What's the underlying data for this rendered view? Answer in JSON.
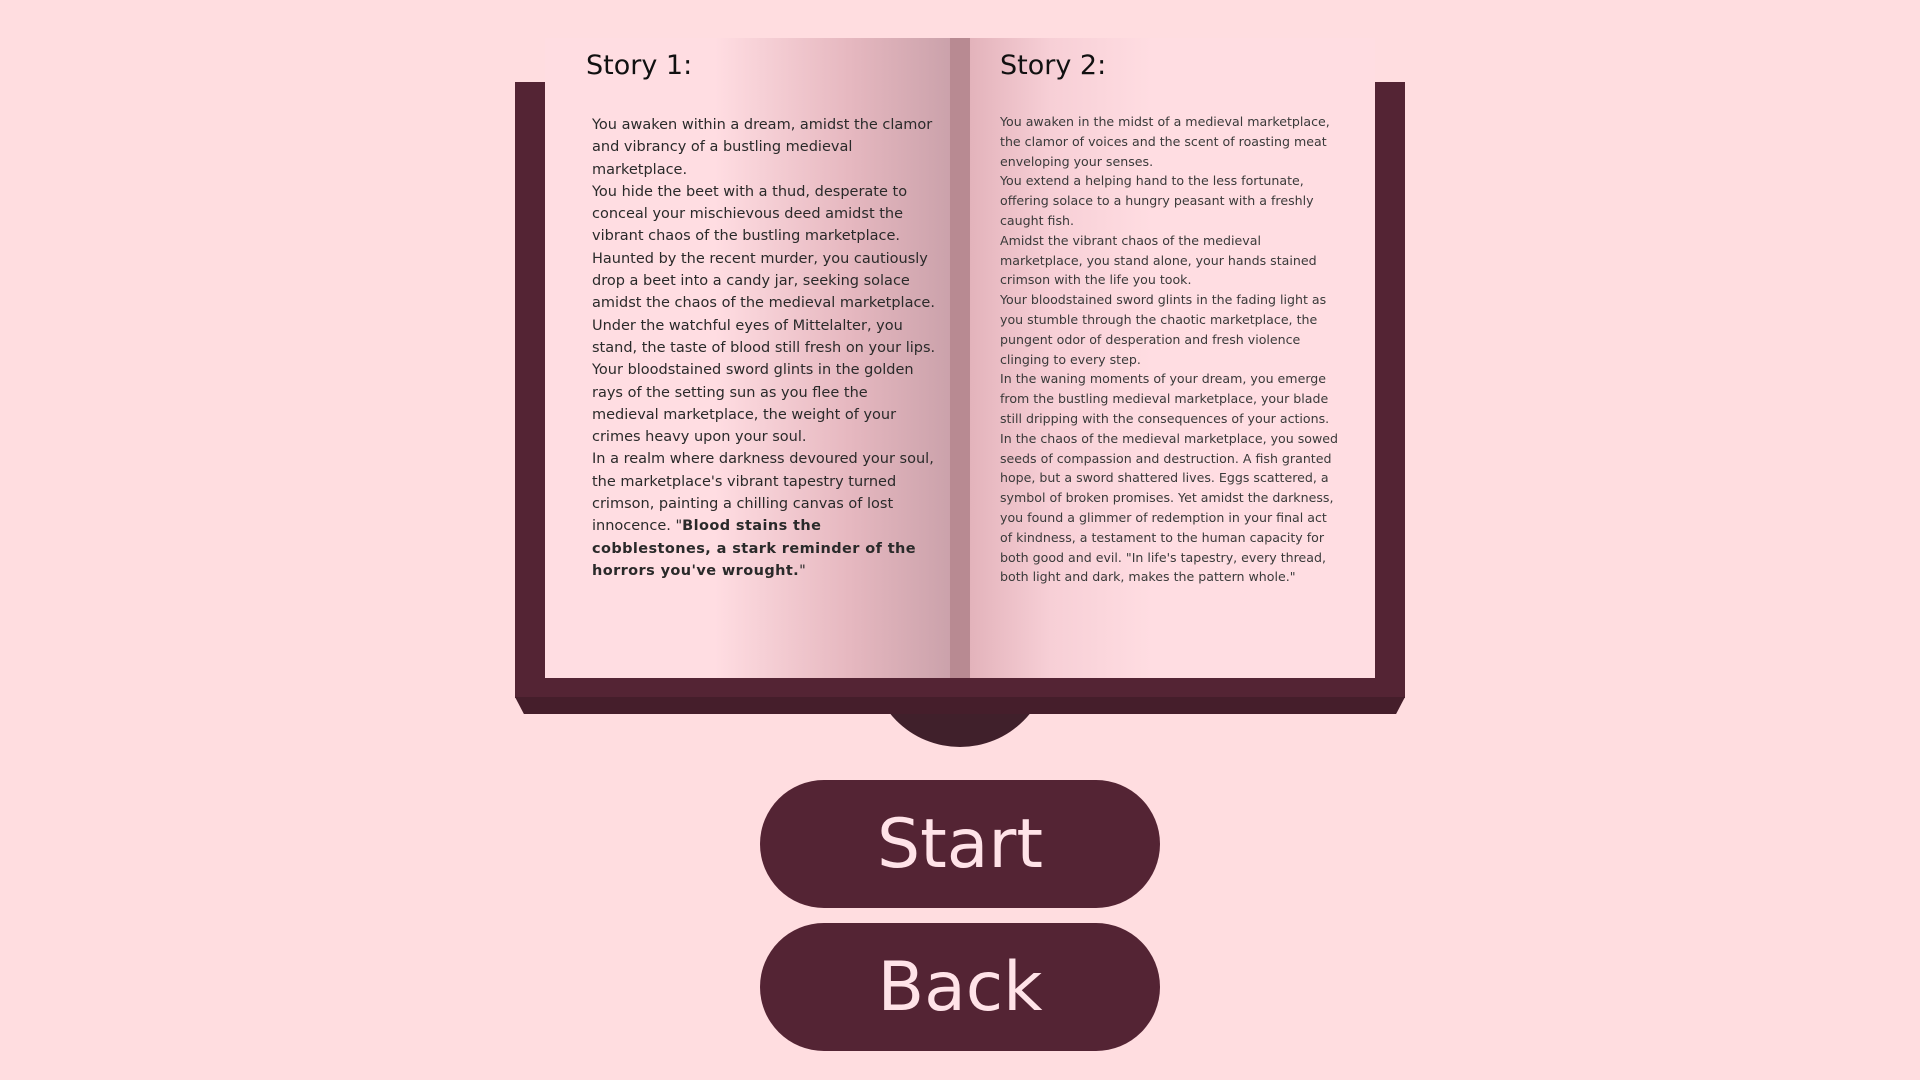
{
  "book": {
    "left_page": {
      "title": "Story 1:",
      "paragraphs": [
        "You awaken within a dream, amidst the clamor and vibrancy of a bustling medieval marketplace.",
        "You hide the beet with a thud, desperate to conceal your mischievous deed amidst the vibrant chaos of the bustling marketplace.",
        "Haunted by the recent murder, you cautiously drop a beet into a candy jar, seeking solace amidst the chaos of the medieval marketplace.",
        "Under the watchful eyes of Mittelalter, you stand, the taste of blood still fresh on your lips.",
        "Your bloodstained sword glints in the golden rays of the setting sun as you flee the medieval marketplace, the weight of your crimes heavy upon your soul."
      ],
      "last_paragraph_start": "In a realm where darkness devoured your soul, the marketplace's vibrant tapestry turned crimson, painting a chilling canvas of lost innocence. \"",
      "last_paragraph_quote": "Blood stains the cobblestones, a stark reminder of the horrors you've wrought.",
      "last_paragraph_end": "\""
    },
    "right_page": {
      "title": "Story 2:",
      "paragraphs": [
        "You awaken in the midst of a medieval marketplace, the clamor of voices and the scent of roasting meat enveloping your senses.",
        "You extend a helping hand to the less fortunate, offering solace to a hungry peasant with a freshly caught fish.",
        "Amidst the vibrant chaos of the medieval marketplace, you stand alone, your hands stained crimson with the life you took.",
        "Your bloodstained sword glints in the fading light as you stumble through the chaotic marketplace, the pungent odor of desperation and fresh violence clinging to every step.",
        "In the waning moments of your dream, you emerge from the bustling medieval marketplace, your blade still dripping with the consequences of your actions.",
        "In the chaos of the medieval marketplace, you sowed seeds of compassion and destruction. A fish granted hope, but a sword shattered lives. Eggs scattered, a symbol of broken promises. Yet amidst the darkness, you found a glimmer of redemption in your final act of kindness, a testament to the human capacity for both good and evil. \"In life's tapestry, every thread, both light and dark, makes the pattern whole.\""
      ]
    }
  },
  "buttons": {
    "start_label": "Start",
    "back_label": "Back"
  },
  "colors": {
    "background": "#ffdde0",
    "book_cover": "#542434",
    "button_bg": "#542434",
    "button_text": "#ffe3e8"
  }
}
